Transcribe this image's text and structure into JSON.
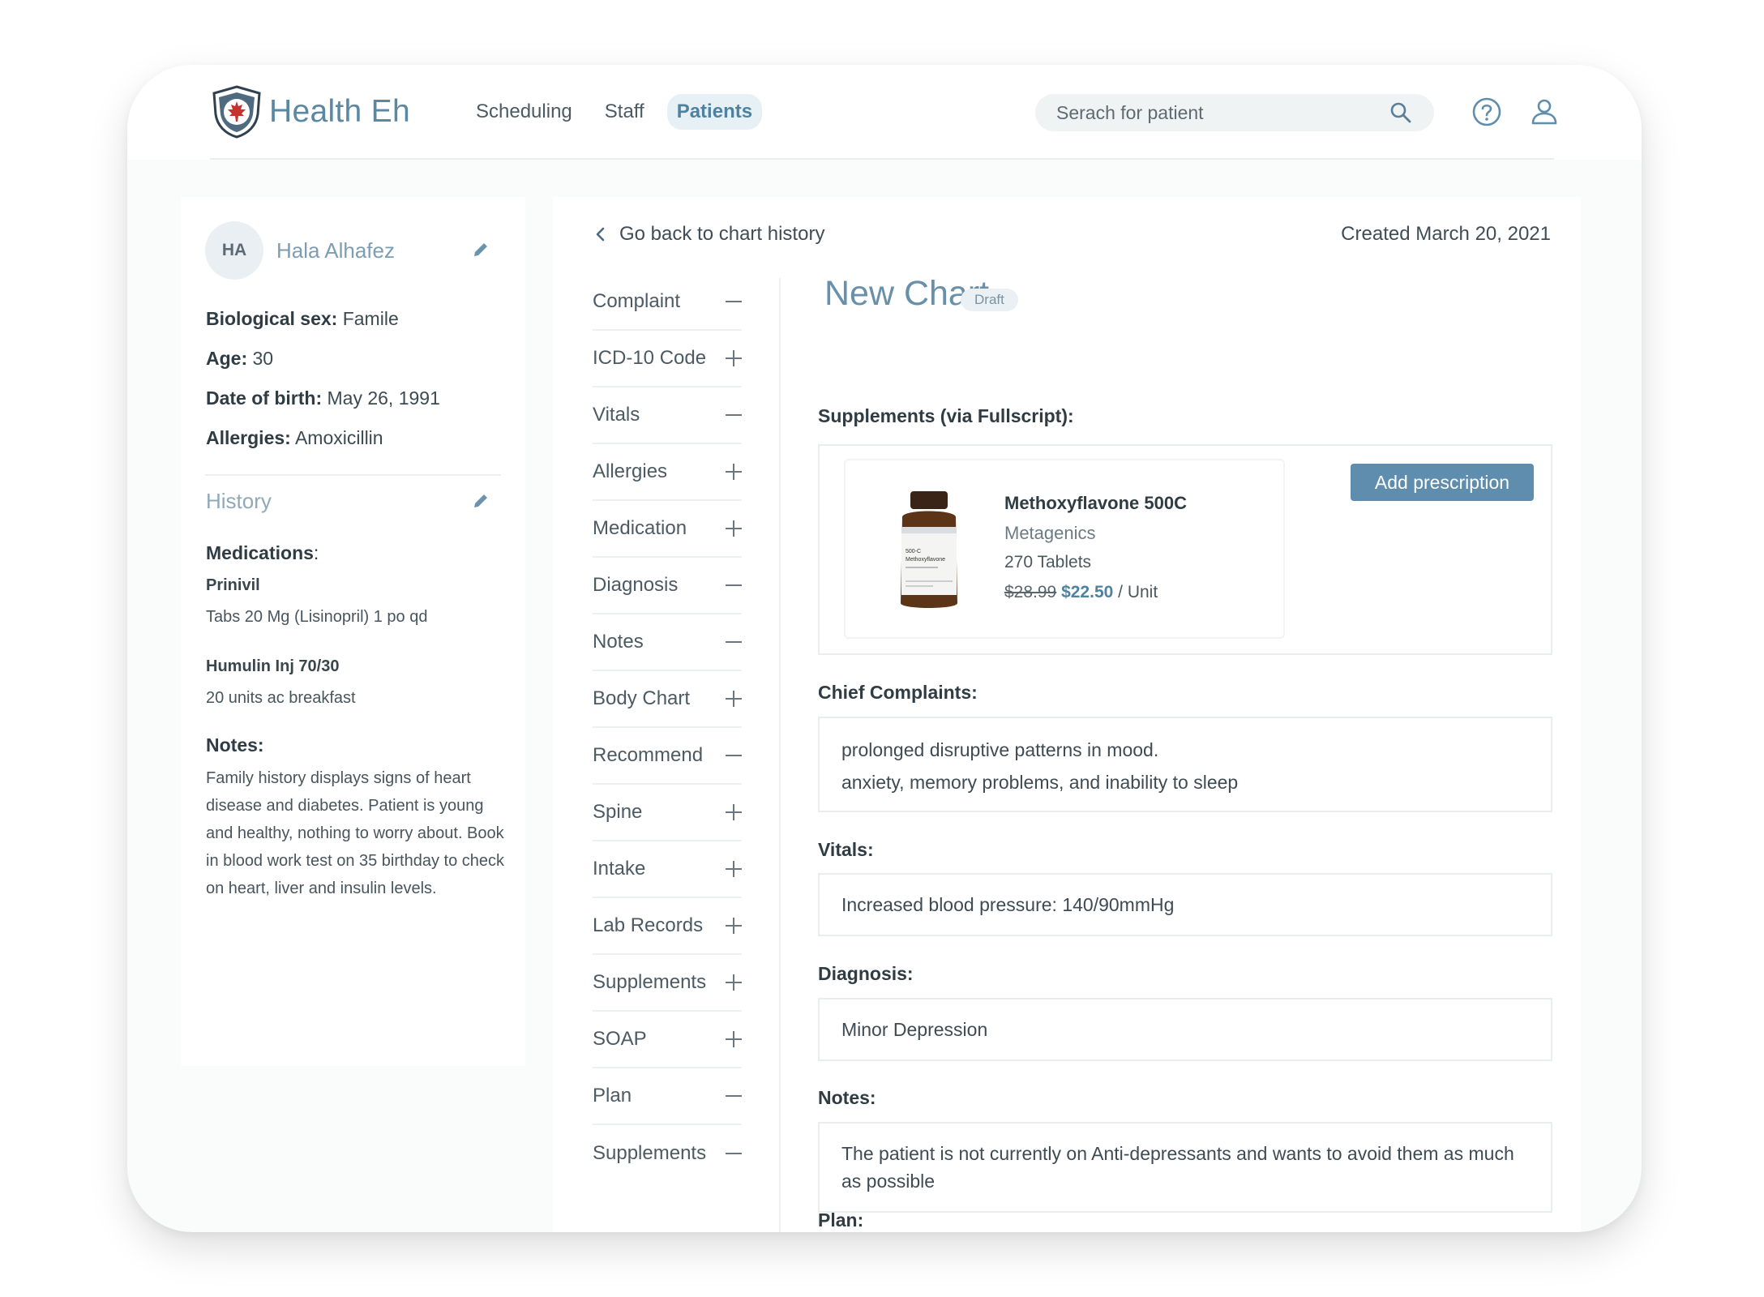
{
  "app": {
    "name": "Health Eh"
  },
  "nav": {
    "items": [
      {
        "label": "Scheduling",
        "active": false
      },
      {
        "label": "Staff",
        "active": false
      },
      {
        "label": "Patients",
        "active": true
      }
    ]
  },
  "search": {
    "placeholder": "Serach for patient"
  },
  "icons": {
    "search": "search-icon",
    "help": "help-circle-icon",
    "user": "user-icon",
    "edit": "pencil-icon",
    "back": "chevron-left-icon",
    "expand": "plus-icon",
    "collapse": "minus-icon"
  },
  "colors": {
    "accent": "#5f8dad",
    "brand": "#5a87a3",
    "title": "#6990ab",
    "shield_red": "#c8322d"
  },
  "patient": {
    "initials": "HA",
    "name": "Hala Alhafez",
    "sex_label": "Biological sex:",
    "sex": "Famile",
    "age_label": "Age:",
    "age": "30",
    "dob_label": "Date of birth:",
    "dob": "May 26, 1991",
    "allergies_label": "Allergies:",
    "allergies": "Amoxicillin"
  },
  "history": {
    "title": "History",
    "medications_label": "Medications",
    "medications_colon": ":",
    "medications": [
      {
        "name": "Prinivil",
        "dosage": "Tabs 20 Mg (Lisinopril) 1 po qd"
      },
      {
        "name": "Humulin Inj 70/30",
        "dosage": "20 units ac breakfast"
      }
    ],
    "notes_label": "Notes:",
    "notes": "Family history displays signs of heart disease and diabetes. Patient is young and healthy, nothing to worry about. Book in blood work test on 35 birthday to check on heart, liver and insulin levels."
  },
  "chart": {
    "back_label": "Go back to chart history",
    "created": "Created March 20, 2021",
    "title": "New Chart",
    "status": "Draft",
    "sections": [
      {
        "label": "Complaint",
        "expanded": true
      },
      {
        "label": "ICD-10 Code",
        "expanded": false
      },
      {
        "label": "Vitals",
        "expanded": true
      },
      {
        "label": "Allergies",
        "expanded": false
      },
      {
        "label": "Medication",
        "expanded": false
      },
      {
        "label": "Diagnosis",
        "expanded": true
      },
      {
        "label": "Notes",
        "expanded": true
      },
      {
        "label": "Body Chart",
        "expanded": false
      },
      {
        "label": "Recommend",
        "expanded": true
      },
      {
        "label": "Spine",
        "expanded": false
      },
      {
        "label": "Intake",
        "expanded": false
      },
      {
        "label": "Lab Records",
        "expanded": false
      },
      {
        "label": "Supplements",
        "expanded": false
      },
      {
        "label": "SOAP",
        "expanded": false
      },
      {
        "label": "Plan",
        "expanded": true
      },
      {
        "label": "Supplements",
        "expanded": true
      }
    ],
    "supplements_label": "Supplements (via Fullscript):",
    "supplement": {
      "name": "Methoxyflavone 500C",
      "brand": "Metagenics",
      "count": "270 Tablets",
      "old_price": "$28.99",
      "new_price": "$22.50",
      "unit": " / Unit",
      "bottle_label_line1": "500-C",
      "bottle_label_line2": "Methoxyflavone"
    },
    "add_prescription_label": "Add prescription",
    "complaints_label": "Chief Complaints:",
    "complaints": [
      "prolonged disruptive patterns in mood.",
      "anxiety, memory problems, and inability to sleep"
    ],
    "vitals_label": "Vitals:",
    "vitals": "Increased blood pressure: 140/90mmHg",
    "diagnosis_label": "Diagnosis:",
    "diagnosis": "Minor Depression",
    "notes_label": "Notes:",
    "notes": "The patient is not currently on Anti-depressants and wants to avoid them as much as possible",
    "plan_label": "Plan:"
  }
}
